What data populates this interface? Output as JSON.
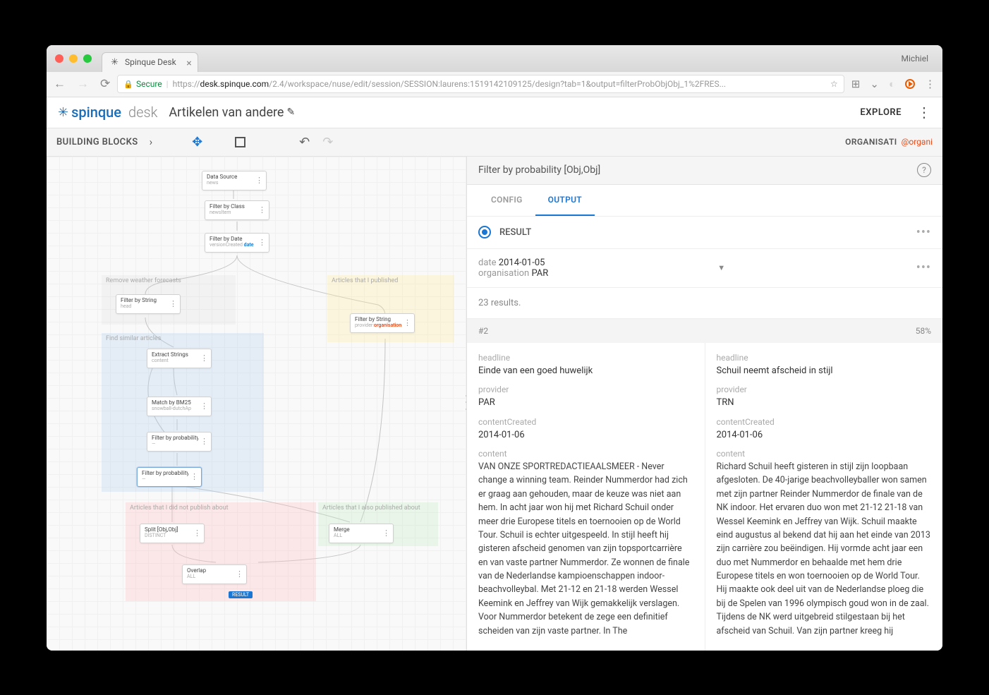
{
  "browser": {
    "profile": "Michiel",
    "tab_title": "Spinque Desk",
    "url_secure": "Secure",
    "url_scheme": "https://",
    "url_host": "desk.spinque.com",
    "url_path": "/2.4/workspace/nuse/edit/session/SESSION:laurens:1519142109125/design?tab=1&output=filterProbObjObj_1%2FRES..."
  },
  "app": {
    "logo_brand": "spinque",
    "logo_sub": "desk",
    "workspace": "Artikelen van andere",
    "explore": "EXPLORE"
  },
  "toolbar": {
    "building_blocks": "BUILDING BLOCKS",
    "org_label": "ORGANISATI",
    "org_value": "@organi"
  },
  "regions": {
    "remove_weather": "Remove weather forecasts",
    "articles_published": "Articles that I published",
    "find_similar": "Find similar articles",
    "not_published": "Articles that I did not publish about",
    "also_published": "Articles that I also published about"
  },
  "nodes": {
    "data_source": {
      "title": "Data Source",
      "sub": "news"
    },
    "filter_class": {
      "title": "Filter by Class",
      "sub": "newsItem"
    },
    "filter_date": {
      "title": "Filter by Date",
      "sub1": "versionCreated ",
      "sub2": "date"
    },
    "filter_string1": {
      "title": "Filter by String",
      "sub": "head"
    },
    "filter_string2": {
      "title": "Filter by String",
      "sub1": "provider:",
      "sub2": "organisation"
    },
    "extract_strings": {
      "title": "Extract Strings",
      "sub": "content"
    },
    "match_bm25": {
      "title": "Match by BM25",
      "sub": "snowball-dutchAp"
    },
    "filter_prob1": {
      "title": "Filter by probability...",
      "sub": "—"
    },
    "filter_prob2": {
      "title": "Filter by probability...",
      "sub": "—"
    },
    "split": {
      "title": "Split [Obj,Obj]",
      "sub": "DISTINCT"
    },
    "merge": {
      "title": "Merge",
      "sub": "ALL"
    },
    "overlap": {
      "title": "Overlap",
      "sub": "ALL"
    },
    "result_badge": "RESULT"
  },
  "right_panel": {
    "title": "Filter by probability [Obj,Obj]",
    "tab_config": "CONFIG",
    "tab_output": "OUTPUT",
    "result_label": "RESULT",
    "params": {
      "date_key": "date",
      "date_val": "2014-01-05",
      "org_key": "organisation",
      "org_val": "PAR"
    },
    "count": "23 results.",
    "filter_num": "#2",
    "filter_pct": "58%",
    "cards": [
      {
        "headline_label": "headline",
        "headline": "Einde van een goed huwelijk",
        "provider_label": "provider",
        "provider": "PAR",
        "created_label": "contentCreated",
        "created": "2014-01-06",
        "content_label": "content",
        "content": "VAN ONZE SPORTREDACTIEAALSMEER - Never change a winning team. Reinder Nummerdor had zich er graag aan gehouden, maar de keuze was niet aan hem. In acht jaar won hij met Richard Schuil onder meer drie Europese titels en toernooien op de World Tour. Schuil is echter uitgespeeld. In stijl heeft hij gisteren afscheid genomen van zijn topsportcarrière en van vaste partner Nummerdor. Ze wonnen de finale van de Nederlandse kampioenschappen indoor-beachvolleybal. Met 21-12 en 21-18 werden Wessel Keemink en Jeffrey van Wijk gemakkelijk verslagen. Voor Nummerdor betekent de zege een definitief scheiden van zijn vaste partner. In The"
      },
      {
        "headline_label": "headline",
        "headline": "Schuil neemt afscheid in stijl",
        "provider_label": "provider",
        "provider": "TRN",
        "created_label": "contentCreated",
        "created": "2014-01-06",
        "content_label": "content",
        "content": "Richard Schuil heeft gisteren in stijl zijn loopbaan afgesloten. De 40-jarige beachvolleyballer won samen met zijn partner Reinder Nummerdor de finale van de NK indoor. Het ervaren duo won met 21-12 21-18 van Wessel Keemink en Jeffrey van Wijk. Schuil maakte eind augustus al bekend dat hij aan het einde van 2013 zijn carrière zou beëindigen. Hij vormde acht jaar een duo met Nummerdor en behaalde met hem drie Europese titels en won toernooien op de World Tour. Hij maakte ook deel uit van de Nederlandse ploeg die bij de Spelen van 1996 olympisch goud won in de zaal. Tijdens de NK werd uitgebreid stilgestaan bij het afscheid van Schuil. Van zijn partner kreeg hij"
      }
    ]
  }
}
